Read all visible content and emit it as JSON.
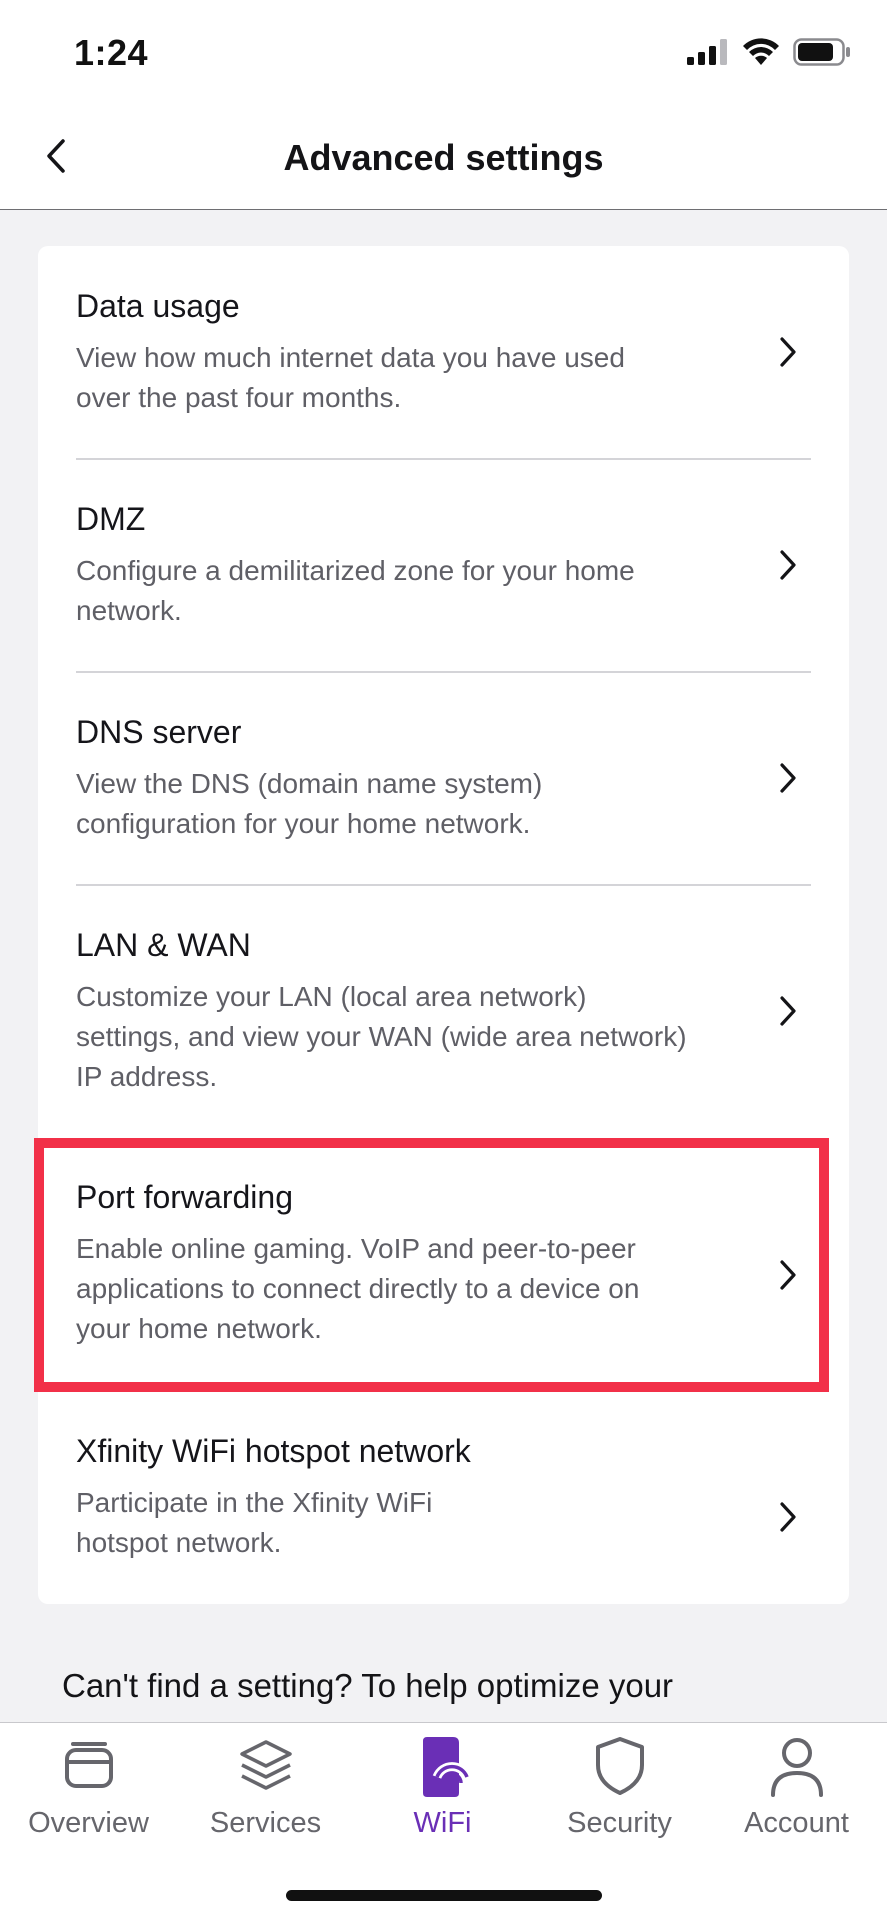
{
  "status": {
    "time": "1:24"
  },
  "header": {
    "title": "Advanced settings",
    "back_icon": "chevron-left-icon"
  },
  "settings": [
    {
      "title": "Data usage",
      "description": "View how much internet data you have used over the past four months."
    },
    {
      "title": "DMZ",
      "description": "Configure a demilitarized zone for your home network."
    },
    {
      "title": "DNS server",
      "description": "View the DNS (domain name system) configuration for your home network."
    },
    {
      "title": "LAN & WAN",
      "description": "Customize your LAN (local area network) settings, and view your WAN (wide area network) IP address."
    },
    {
      "title": "Port forwarding",
      "description": "Enable online gaming. VoIP and peer-to-peer applications to connect directly to a device on your home network."
    },
    {
      "title": "Xfinity WiFi hotspot network",
      "description": "Participate in the Xfinity WiFi hotspot network."
    }
  ],
  "help": {
    "text": "Can't find a setting? To help optimize your"
  },
  "nav": [
    {
      "label": "Overview",
      "icon": "overview-icon"
    },
    {
      "label": "Services",
      "icon": "layers-icon"
    },
    {
      "label": "WiFi",
      "icon": "wifi-router-icon"
    },
    {
      "label": "Security",
      "icon": "shield-icon"
    },
    {
      "label": "Account",
      "icon": "person-icon"
    }
  ],
  "colors": {
    "accent": "#6a2fb6",
    "highlight": "#f23048"
  }
}
